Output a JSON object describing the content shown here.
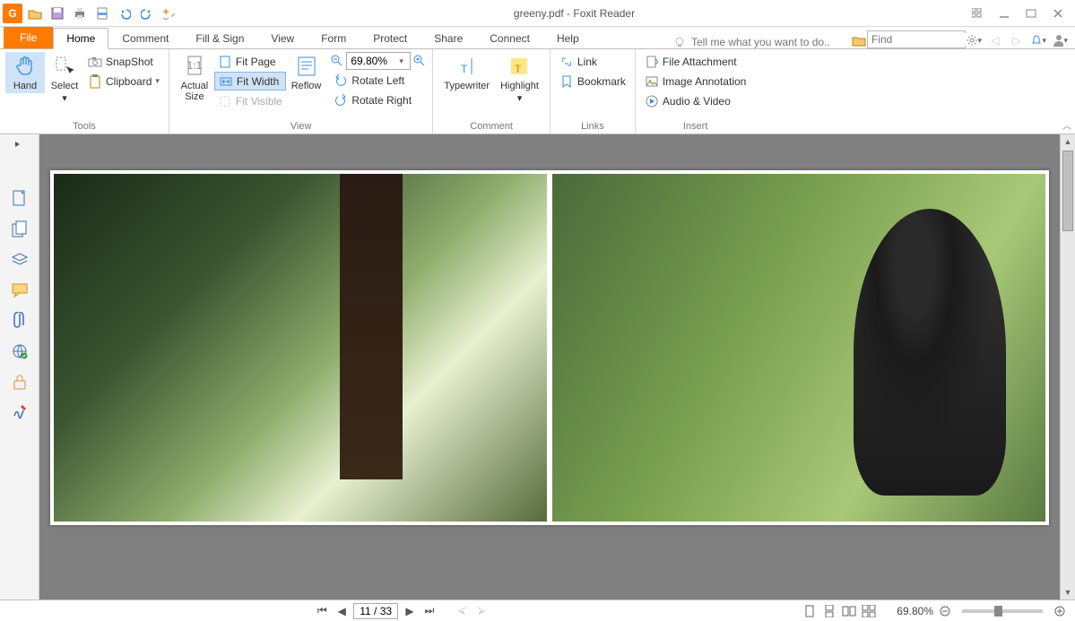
{
  "title": "greeny.pdf - Foxit Reader",
  "qat_icons": [
    "open-folder",
    "save",
    "print",
    "pdf",
    "undo",
    "redo",
    "hand-dropdown"
  ],
  "tabs": {
    "file": "File",
    "items": [
      "Home",
      "Comment",
      "Fill & Sign",
      "View",
      "Form",
      "Protect",
      "Share",
      "Connect",
      "Help"
    ],
    "active": "Home"
  },
  "tellme_placeholder": "Tell me what you want to do..",
  "find_placeholder": "Find",
  "ribbon": {
    "tools": {
      "label": "Tools",
      "hand": "Hand",
      "select": "Select",
      "snapshot": "SnapShot",
      "clipboard": "Clipboard"
    },
    "view": {
      "label": "View",
      "actual_size": "Actual\nSize",
      "fit_page": "Fit Page",
      "fit_width": "Fit Width",
      "fit_visible": "Fit Visible",
      "reflow": "Reflow",
      "zoom_value": "69.80%",
      "rotate_left": "Rotate Left",
      "rotate_right": "Rotate Right"
    },
    "comment": {
      "label": "Comment",
      "typewriter": "Typewriter",
      "highlight": "Highlight"
    },
    "links": {
      "label": "Links",
      "link": "Link",
      "bookmark": "Bookmark"
    },
    "insert": {
      "label": "Insert",
      "file_attachment": "File Attachment",
      "image_annotation": "Image Annotation",
      "audio_video": "Audio & Video"
    }
  },
  "nav_icons": [
    "page",
    "pages",
    "layers",
    "comments",
    "attachments",
    "connected",
    "security",
    "signatures"
  ],
  "status": {
    "page_display": "11 / 33",
    "zoom_display": "69.80%"
  }
}
